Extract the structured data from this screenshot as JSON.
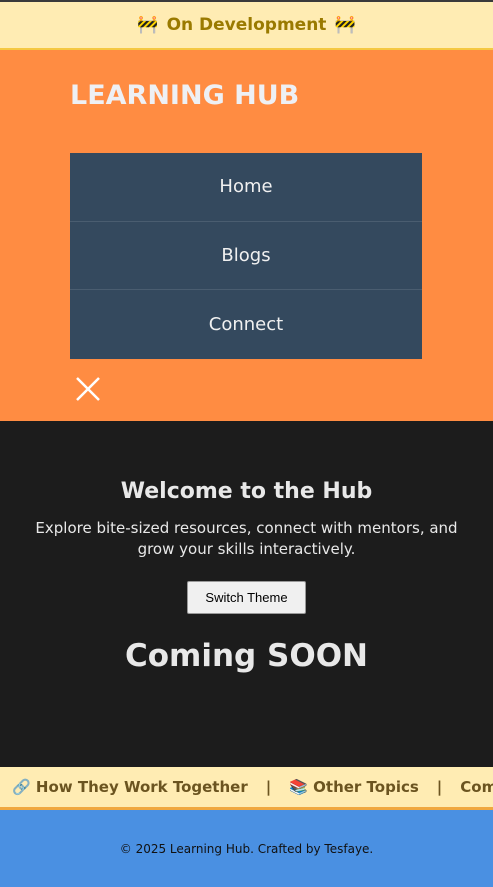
{
  "banner": {
    "icon": "construction-icon",
    "emoji": "🚧",
    "text": "On Development"
  },
  "header": {
    "logo": "LEARNING HUB",
    "nav": [
      "Home",
      "Blogs",
      "Connect"
    ]
  },
  "main": {
    "title": "Welcome to the Hub",
    "desc": "Explore bite-sized resources, connect with mentors, and grow your skills interactively.",
    "theme_button": "Switch Theme",
    "coming": "Coming SOON"
  },
  "ticker": {
    "items": [
      {
        "emoji": "🔗",
        "label": "How They Work Together"
      },
      {
        "emoji": "📚",
        "label": "Other Topics"
      },
      {
        "emoji": "",
        "label": "Coming SOON"
      }
    ],
    "separator": "|"
  },
  "footer": {
    "text": "© 2025 Learning Hub. Crafted by Tesfaye."
  }
}
